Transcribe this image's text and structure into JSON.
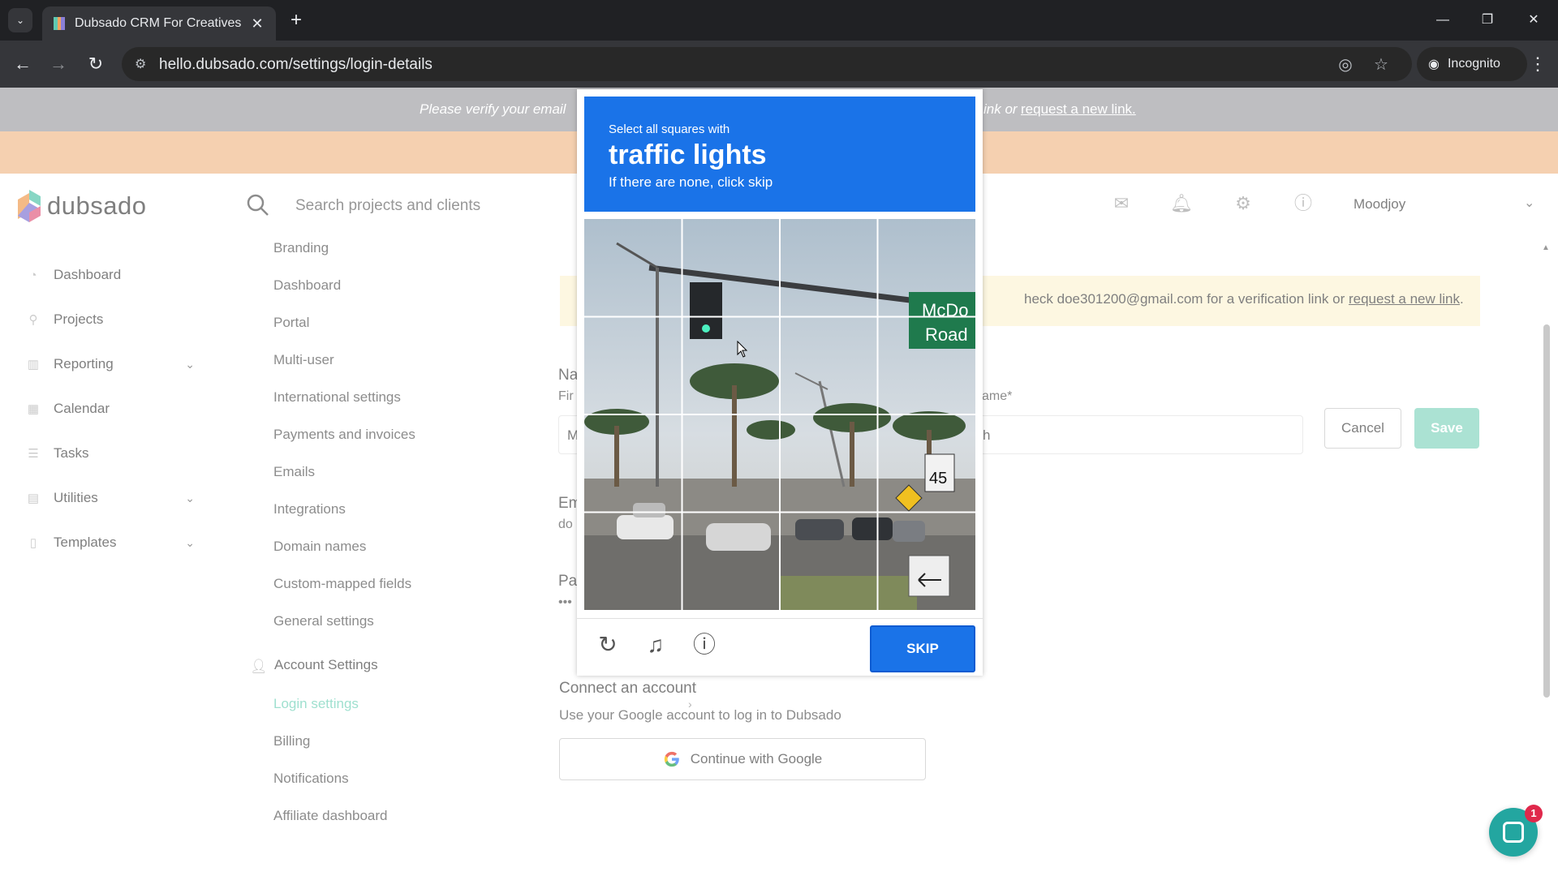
{
  "browser": {
    "tab_title": "Dubsado CRM For Creatives",
    "url": "hello.dubsado.com/settings/login-details",
    "incognito_label": "Incognito"
  },
  "banner": {
    "text": "Please verify your email",
    "link_prefix": "ink or",
    "link": "request a new link."
  },
  "header": {
    "logo": "dubsado",
    "search_placeholder": "Search projects and clients",
    "user_name": "Moodjoy"
  },
  "sidebar": {
    "items": [
      {
        "label": "Dashboard",
        "icon": "dashboard-icon"
      },
      {
        "label": "Projects",
        "icon": "projects-icon"
      },
      {
        "label": "Reporting",
        "icon": "reporting-icon"
      },
      {
        "label": "Calendar",
        "icon": "calendar-icon"
      },
      {
        "label": "Tasks",
        "icon": "tasks-icon"
      },
      {
        "label": "Utilities",
        "icon": "utilities-icon"
      },
      {
        "label": "Templates",
        "icon": "templates-icon"
      }
    ]
  },
  "settings_nav": {
    "items": [
      "Branding",
      "Dashboard",
      "Portal",
      "Multi-user",
      "International settings",
      "Payments and invoices",
      "Emails",
      "Integrations",
      "Domain names",
      "Custom-mapped fields",
      "General settings"
    ],
    "account_heading": "Account Settings",
    "account_items": [
      "Login settings",
      "Billing",
      "Notifications",
      "Affiliate dashboard"
    ]
  },
  "content": {
    "alert_text": "heck doe301200@gmail.com for a verification link or",
    "alert_link": "request a new link",
    "alert_end": ".",
    "name_label_partial": "Na",
    "first_label_partial": "Fir",
    "first_value_partial": "M",
    "last_label_partial": "ame*",
    "last_value_partial": "h",
    "cancel_label": "Cancel",
    "save_label": "Save",
    "email_label_partial": "Em",
    "email_value_partial": "do",
    "password_label_partial": "Pa",
    "password_value_partial": "•••",
    "connect_title": "Connect an account",
    "connect_sub": "Use your Google account to log in to Dubsado",
    "google_button": "Continue with Google"
  },
  "chat": {
    "badge": "1"
  },
  "captcha": {
    "line1": "Select all squares with",
    "target": "traffic lights",
    "line3": "If there are none, click skip",
    "skip_label": "SKIP",
    "sign_text_1": "McDo",
    "sign_text_2": "Road",
    "speed_sign": "45"
  },
  "colors": {
    "captcha_blue": "#1a73e8",
    "accent_teal": "#7fd6bf",
    "banner_orange": "#f2c196",
    "banner_grey": "#a8a9ad"
  }
}
